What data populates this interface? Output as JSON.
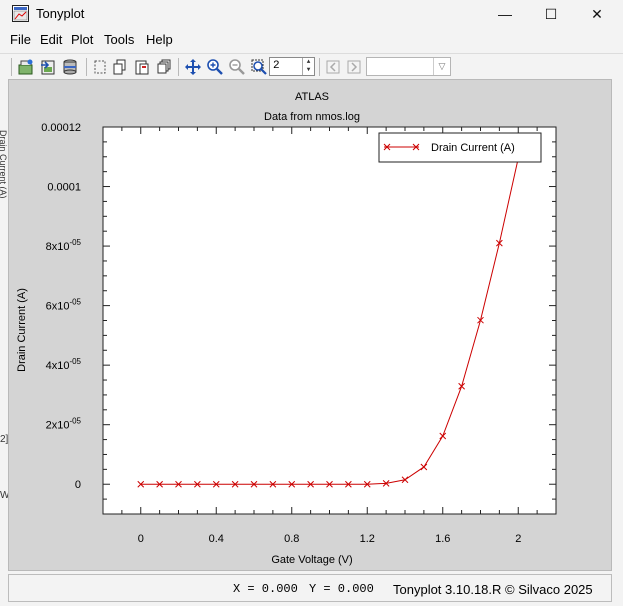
{
  "window": {
    "title": "Tonyplot",
    "minimize_glyph": "—",
    "maximize_glyph": "☐",
    "close_glyph": "✕"
  },
  "menu": [
    "File",
    "Edit",
    "Plot",
    "Tools",
    "Help"
  ],
  "toolbar": {
    "icons": [
      "open-icon",
      "import-icon",
      "print-icon",
      "select-icon",
      "copy-icon",
      "paste-icon",
      "overlay-icon",
      "pan-icon",
      "zoom-in-icon",
      "zoom-out-icon",
      "zoom-box-icon",
      "prev-icon",
      "next-icon"
    ],
    "spin_value": "2",
    "combo_value": ""
  },
  "plot": {
    "title": "ATLAS",
    "subtitle": "Data from nmos.log",
    "legend_label": "Drain Current (A)"
  },
  "chart_data": {
    "type": "line",
    "title": "ATLAS",
    "subtitle": "Data from nmos.log",
    "xlabel": "Gate Voltage (V)",
    "ylabel": "Drain Current (A)",
    "xlim": [
      -0.2,
      2.2
    ],
    "ylim": [
      -1e-05,
      0.00012
    ],
    "x_ticks": [
      0,
      0.4,
      0.8,
      1.2,
      1.6,
      2
    ],
    "x_tick_labels": [
      "0",
      "0.4",
      "0.8",
      "1.2",
      "1.6",
      "2"
    ],
    "y_ticks": [
      0,
      2e-05,
      4e-05,
      6e-05,
      8e-05,
      0.0001,
      0.00012
    ],
    "y_tick_labels": [
      {
        "mantissa": "0",
        "exp": ""
      },
      {
        "mantissa": "2x10",
        "exp": "-05"
      },
      {
        "mantissa": "4x10",
        "exp": "-05"
      },
      {
        "mantissa": "6x10",
        "exp": "-05"
      },
      {
        "mantissa": "8x10",
        "exp": "-05"
      },
      {
        "mantissa": "0.0001",
        "exp": ""
      },
      {
        "mantissa": "0.00012",
        "exp": ""
      }
    ],
    "legend_placement": "top-right",
    "series": [
      {
        "name": "Drain Current (A)",
        "color": "#cc0000",
        "marker": "x",
        "x": [
          0,
          0.1,
          0.2,
          0.3,
          0.4,
          0.5,
          0.6,
          0.7,
          0.8,
          0.9,
          1.0,
          1.1,
          1.2,
          1.3,
          1.4,
          1.5,
          1.6,
          1.7,
          1.8,
          1.9,
          2.0
        ],
        "y": [
          0,
          0,
          0,
          0,
          0,
          0,
          0,
          0,
          0,
          0,
          0,
          0,
          0,
          3e-07,
          1.5e-06,
          5.8e-06,
          1.62e-05,
          3.29e-05,
          5.51e-05,
          8.1e-05,
          0.0001095
        ]
      }
    ]
  },
  "status": {
    "x_label": "X = 0.000",
    "y_label": "Y = 0.000",
    "version": "Tonyplot 3.10.18.R © Silvaco 2025"
  },
  "left_fragments": [
    "Drain Current (A)",
    "2]",
    "W"
  ]
}
